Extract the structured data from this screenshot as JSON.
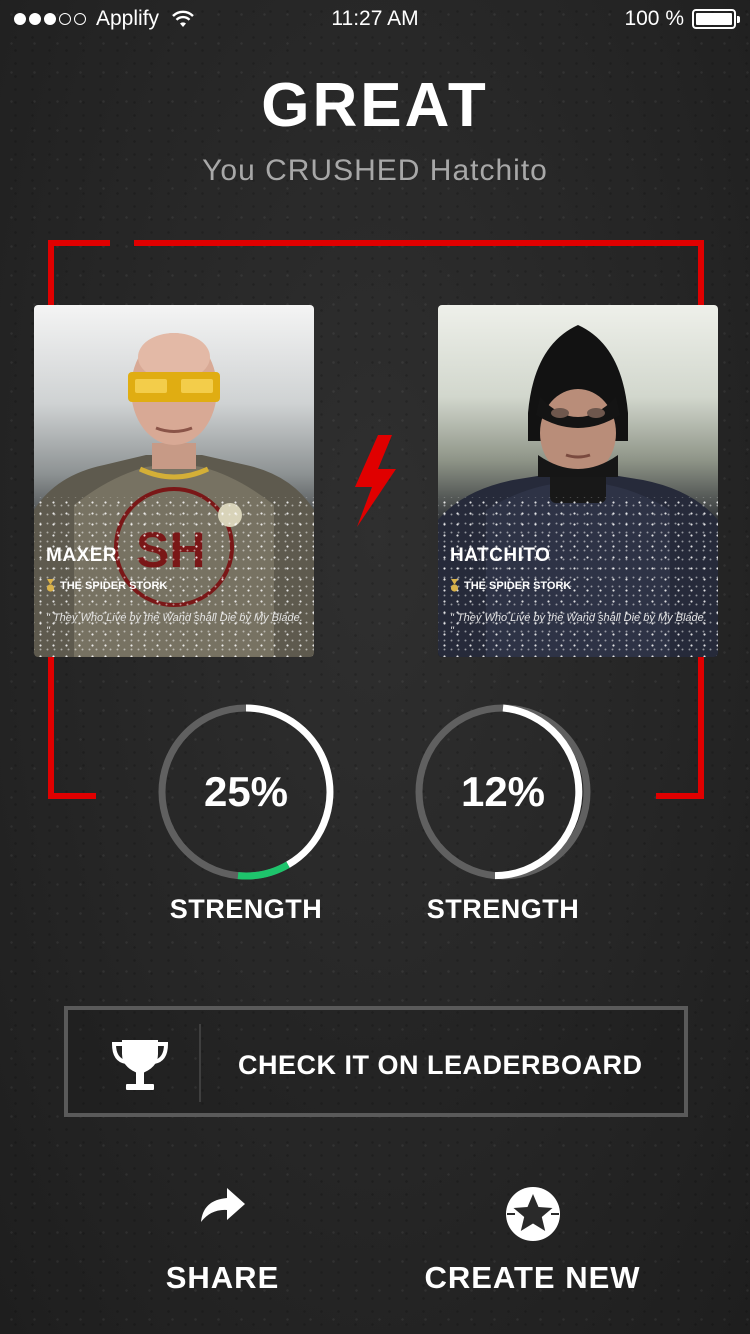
{
  "status_bar": {
    "signal_bars_filled": 3,
    "signal_bars_total": 5,
    "carrier": "Applify",
    "time": "11:27 AM",
    "battery_percent": "100 %"
  },
  "result": {
    "headline": "GREAT",
    "subtitle": "You CRUSHED Hatchito"
  },
  "fighters": [
    {
      "name": "MAXER",
      "team": "THE SPIDER STORK",
      "quote": "\" They Who Live by the Wand shall Die by My Blade. \"",
      "strength_percent": "25%",
      "strength_value": 0.25,
      "strength_label": "STRENGTH"
    },
    {
      "name": "HATCHITO",
      "team": "THE SPIDER STORK",
      "quote": "\" They Who Live by the Wand shall Die by My Blade. \"",
      "strength_percent": "12%",
      "strength_value": 0.12,
      "strength_label": "STRENGTH"
    }
  ],
  "leaderboard": {
    "label": "CHECK IT ON LEADERBOARD",
    "icon": "trophy-icon"
  },
  "actions": {
    "share_label": "SHARE",
    "share_icon": "share-arrow-icon",
    "create_label": "CREATE NEW",
    "create_icon": "star-badge-icon"
  },
  "colors": {
    "accent_red": "#e00000",
    "gauge_green": "#1ec46c",
    "gauge_track": "#606060",
    "gauge_fill": "#ffffff",
    "medal_gold": "#d9b24a"
  }
}
